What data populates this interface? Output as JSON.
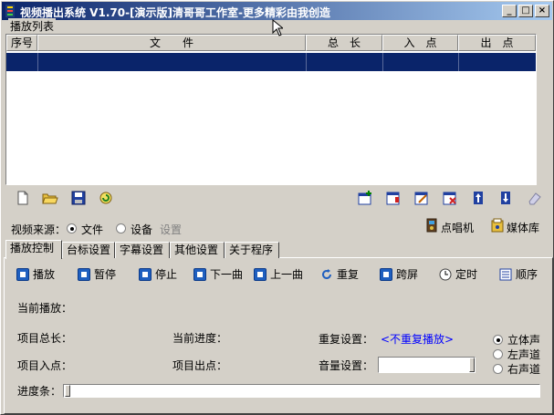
{
  "window": {
    "title": "视频播出系统 V1.70-[演示版]清哥哥工作室-更多精彩由我创造",
    "min_symbol": "_",
    "max_symbol": "□",
    "close_symbol": "×"
  },
  "playlist": {
    "group_label": "播放列表",
    "columns": [
      "序号",
      "文　　件",
      "总　长",
      "入　点",
      "出　点"
    ],
    "selected_row_index": 0
  },
  "toolbar": {
    "left_icons": [
      "new-icon",
      "open-icon",
      "save-icon",
      "refresh-icon"
    ],
    "right_icons": [
      "add-icon",
      "insert-icon",
      "edit-icon",
      "delete-icon",
      "move-up-icon",
      "move-down-icon",
      "clear-icon"
    ]
  },
  "source": {
    "label": "视频来源：",
    "option_file": "文件",
    "option_device": "设备",
    "settings": "设置",
    "selected": "文件"
  },
  "top_buttons": {
    "karaoke": "点唱机",
    "media_library": "媒体库"
  },
  "tabs": [
    "播放控制",
    "台标设置",
    "字幕设置",
    "其他设置",
    "关于程序"
  ],
  "active_tab": 0,
  "controls": {
    "play": "播放",
    "pause": "暂停",
    "stop": "停止",
    "next": "下一曲",
    "prev": "上一曲",
    "repeat": "重复",
    "cross_screen": "跨屏",
    "timer": "定时",
    "sequence": "顺序"
  },
  "info": {
    "now_playing": "当前播放：",
    "total_length": "项目总长：",
    "current_progress": "当前进度：",
    "repeat_setting": "重复设置：",
    "repeat_value": "<不重复播放>",
    "in_point": "项目入点：",
    "out_point": "项目出点：",
    "volume_setting": "音量设置：",
    "progress_bar": "进度条："
  },
  "audio": {
    "stereo": "立体声",
    "left": "左声道",
    "right": "右声道",
    "selected": "立体声"
  },
  "volume_level": 1.0,
  "progress_level": 0.0,
  "colors": {
    "title_start": "#0a246a",
    "title_end": "#a6caf0",
    "selection": "#0a246a",
    "link_blue": "#0000ff",
    "face": "#d4d0c8"
  }
}
